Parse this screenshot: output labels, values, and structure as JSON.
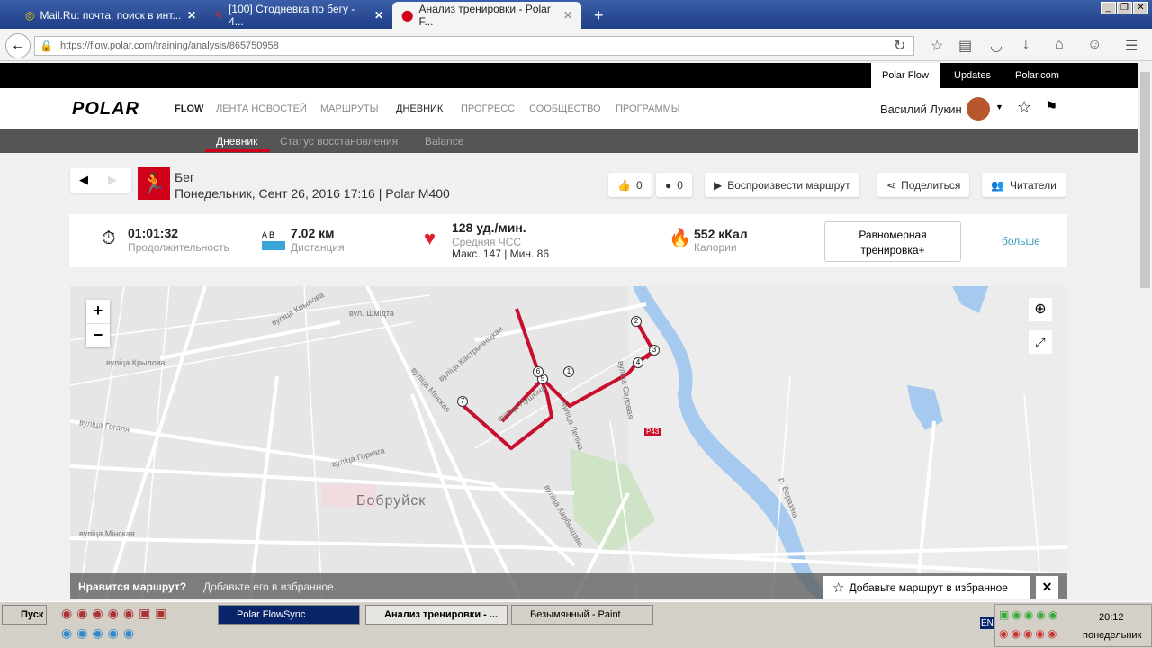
{
  "browser": {
    "tabs": [
      {
        "title": "Mail.Ru: почта, поиск в инт...",
        "icon": "mailru-icon"
      },
      {
        "title": "[100] Стодневка по бегу - 4...",
        "icon": "forum-icon"
      },
      {
        "title": "Анализ тренировки - Polar F...",
        "icon": "polar-icon",
        "active": true
      }
    ],
    "new_tab": "+",
    "url": "https://flow.polar.com/training/analysis/865750958"
  },
  "topbar": {
    "links": [
      "Polar Flow",
      "Updates",
      "Polar.com"
    ]
  },
  "header": {
    "logo": "POLAR",
    "flow": "FLOW",
    "nav": [
      "ЛЕНТА НОВОСТЕЙ",
      "МАРШРУТЫ",
      "ДНЕВНИК",
      "ПРОГРЕСС",
      "СООБЩЕСТВО",
      "ПРОГРАММЫ"
    ],
    "active_nav": "ДНЕВНИК",
    "user": "Василий Лукин"
  },
  "subnav": {
    "items": [
      "Дневник",
      "Статус восстановления",
      "Balance"
    ]
  },
  "training": {
    "sport": "Бег",
    "datetime": "Понедельник, Сент 26, 2016 17:16 | Polar M400",
    "likes": "0",
    "comments": "0",
    "play_route": "Воспроизвести маршрут",
    "share": "Поделиться",
    "followers": "Читатели"
  },
  "stats": {
    "duration": "01:01:32",
    "duration_label": "Продолжительность",
    "distance_ab": "A  B",
    "distance": "7.02 км",
    "distance_label": "Дистанция",
    "hr": "128 уд./мин.",
    "hr_label": "Средняя ЧСС",
    "hr_minmax": "Макс. 147  |  Мин. 86",
    "calories": "552 кКал",
    "calories_label": "Калории",
    "benefit": "Равномерная тренировка+",
    "more": "больше"
  },
  "map": {
    "city": "Бобруйск",
    "zoom_in": "+",
    "zoom_out": "−",
    "markers": [
      "1",
      "2",
      "3",
      "4",
      "5",
      "6",
      "7"
    ],
    "streets": [
      "вуліца Мінская",
      "вуліца Пушкіна",
      "вуліца Гогаля",
      "вуліца Крылова",
      "вуліца Горкага",
      "вул. Шмідта",
      "вуліца Карбышава",
      "вуліца Садовая",
      "р. Беразіна",
      "Р43",
      "вуліца Кастрычніцкая",
      "вуліца Лепіна"
    ],
    "banner_q": "Нравится маршрут?",
    "banner_text": "Добавьте его в избранное.",
    "banner_btn": "Добавьте маршрут в избранное",
    "close": "✕"
  },
  "taskbar": {
    "start": "Пуск",
    "tasks": [
      "Polar FlowSync",
      "Анализ тренировки - ...",
      "Безымянный - Paint"
    ],
    "lang": "EN",
    "time": "20:12",
    "day": "понедельник"
  }
}
